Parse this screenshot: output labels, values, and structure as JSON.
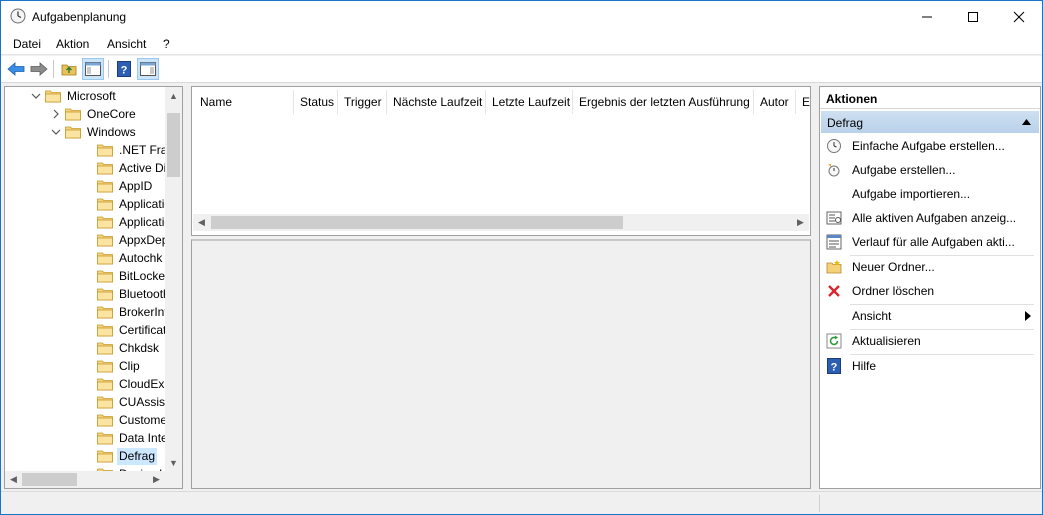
{
  "window": {
    "title": "Aufgabenplanung",
    "app_icon": "clock-icon"
  },
  "menu": {
    "items": [
      "Datei",
      "Aktion",
      "Ansicht",
      "?"
    ]
  },
  "toolbar": {
    "buttons": [
      "back-arrow-icon",
      "forward-arrow-icon",
      "up-folder-icon",
      "show-hide-tree-icon",
      "help-icon",
      "show-hide-action-pane-icon"
    ]
  },
  "tree": {
    "items": [
      {
        "label": "Microsoft",
        "level": 0,
        "expanded": true
      },
      {
        "label": "OneCore",
        "level": 1,
        "expanded": false
      },
      {
        "label": "Windows",
        "level": 1,
        "expanded": true
      },
      {
        "label": ".NET Frame",
        "level": 2
      },
      {
        "label": "Active Direc",
        "level": 2
      },
      {
        "label": "AppID",
        "level": 2
      },
      {
        "label": "Application",
        "level": 2
      },
      {
        "label": "Application",
        "level": 2
      },
      {
        "label": "AppxDeploy",
        "level": 2
      },
      {
        "label": "Autochk",
        "level": 2
      },
      {
        "label": "BitLocker",
        "level": 2
      },
      {
        "label": "Bluetooth",
        "level": 2
      },
      {
        "label": "BrokerInfras",
        "level": 2
      },
      {
        "label": "CertificateS",
        "level": 2
      },
      {
        "label": "Chkdsk",
        "level": 2
      },
      {
        "label": "Clip",
        "level": 2
      },
      {
        "label": "CloudExper",
        "level": 2
      },
      {
        "label": "CUAssistan",
        "level": 2
      },
      {
        "label": "Customer E",
        "level": 2
      },
      {
        "label": "Data Integri",
        "level": 2
      },
      {
        "label": "Defrag",
        "level": 2,
        "selected": true
      },
      {
        "label": "Device Inf",
        "level": 2
      }
    ]
  },
  "task_list": {
    "columns": [
      "Name",
      "Status",
      "Trigger",
      "Nächste Laufzeit",
      "Letzte Laufzeit",
      "Ergebnis der letzten Ausführung",
      "Autor",
      "E"
    ]
  },
  "actions": {
    "header": "Aktionen",
    "section": "Defrag",
    "items": [
      {
        "label": "Einfache Aufgabe erstellen...",
        "icon": "basic-task-icon"
      },
      {
        "label": "Aufgabe erstellen...",
        "icon": "create-task-icon"
      },
      {
        "label": "Aufgabe importieren...",
        "icon": ""
      },
      {
        "label": "Alle aktiven Aufgaben anzeig...",
        "icon": "running-tasks-icon"
      },
      {
        "label": "Verlauf für alle Aufgaben akti...",
        "icon": "history-icon"
      },
      {
        "label": "Neuer Ordner...",
        "icon": "new-folder-icon"
      },
      {
        "label": "Ordner löschen",
        "icon": "delete-icon"
      },
      {
        "label": "Ansicht",
        "icon": "",
        "submenu": true
      },
      {
        "label": "Aktualisieren",
        "icon": "refresh-icon"
      },
      {
        "label": "Hilfe",
        "icon": "help-icon"
      }
    ]
  },
  "colors": {
    "accent": "#1a73c7",
    "selection": "#cce8ff",
    "section_header": "#c4d8ee",
    "delete_red": "#d9262c",
    "folder": "#f5d27a"
  }
}
